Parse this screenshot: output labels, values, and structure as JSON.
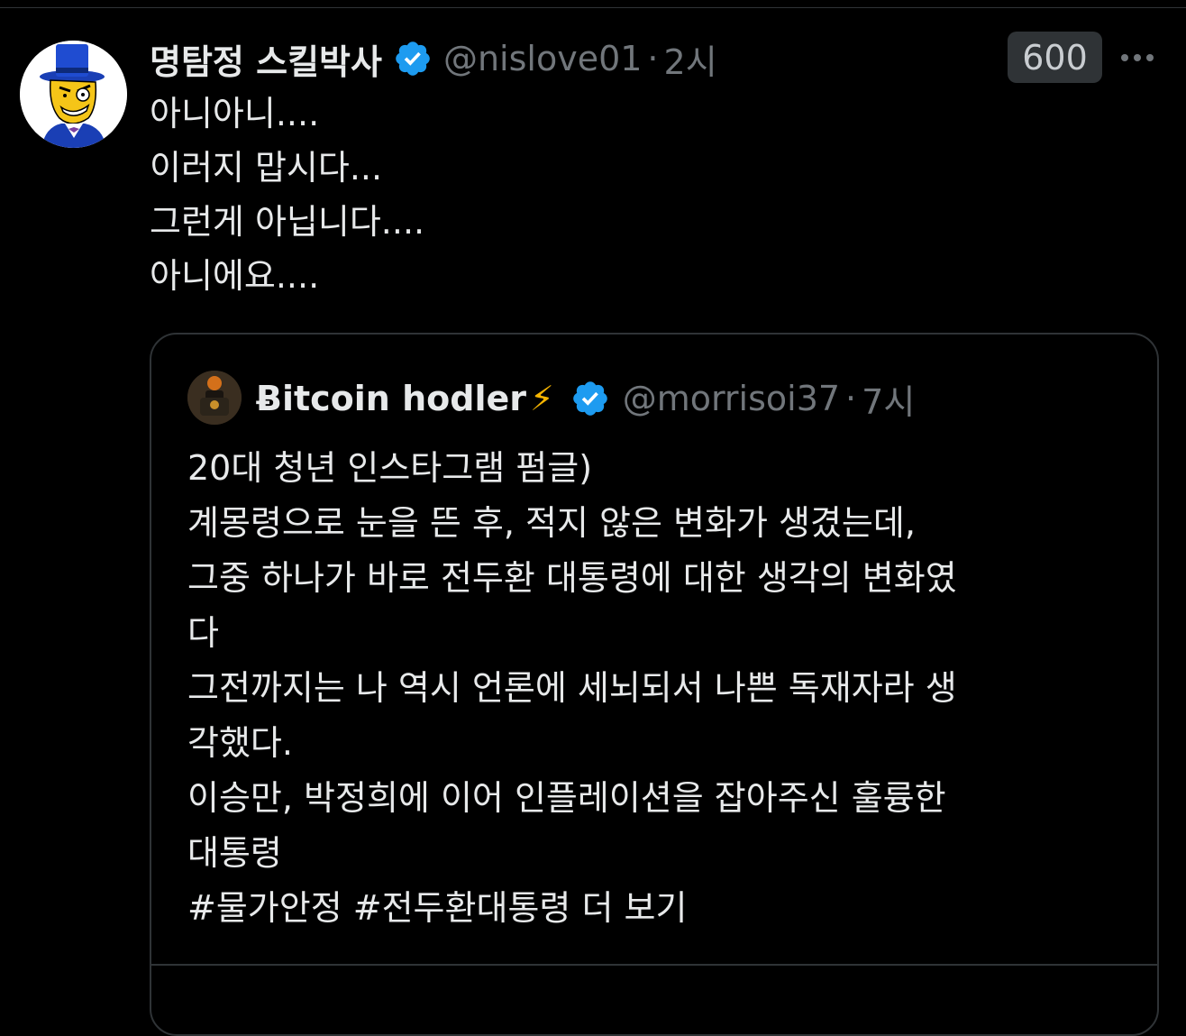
{
  "tweet": {
    "author_name": "명탐정 스킬박사",
    "handle": "@nislove01",
    "separator": "·",
    "time": "2시",
    "view_count": "600",
    "lines": [
      "아니아니....",
      "이러지 맙시다...",
      "그런게 아닙니다....",
      "아니에요...."
    ]
  },
  "quote": {
    "author_name": "Ƀitcoin hodler",
    "emoji": "⚡",
    "handle": "@morrisoi37",
    "separator": "·",
    "time": "7시",
    "lines": [
      "20대 청년 인스타그램 펌글)",
      "계몽령으로 눈을 뜬 후, 적지 않은 변화가 생겼는데,",
      "그중 하나가 바로 전두환 대통령에 대한 생각의 변화였",
      "다",
      "그전까지는 나 역시 언론에 세뇌되서 나쁜 독재자라 생",
      "각했다.",
      "이승만, 박정희에 이어 인플레이션을 잡아주신 훌륭한",
      "대통령"
    ],
    "hashtags": "#물가안정 #전두환대통령",
    "more_link": "더 보기"
  },
  "icons": {
    "verified": "verified-badge-icon",
    "more": "more-options-icon"
  },
  "colors": {
    "background": "#000000",
    "text": "#e7e9ea",
    "secondary_text": "#71767b",
    "border": "#2f3336",
    "verified_blue": "#1d9bf0"
  }
}
